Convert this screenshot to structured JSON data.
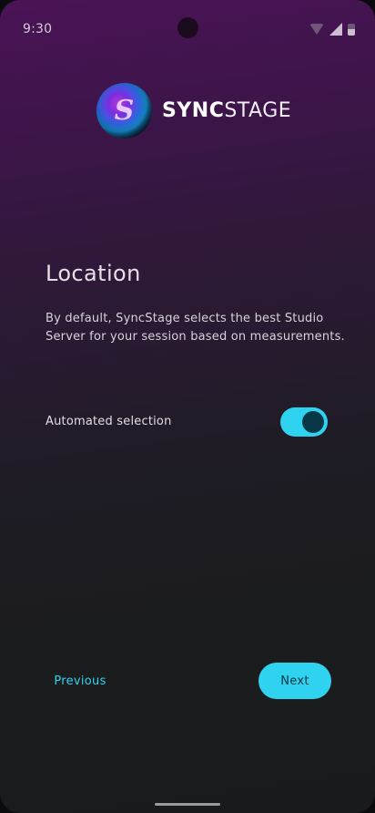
{
  "status_bar": {
    "time": "9:30",
    "icons": [
      "wifi-icon",
      "signal-icon",
      "battery-icon"
    ]
  },
  "logo": {
    "mark": "S",
    "text_bold": "SYNC",
    "text_light": "STAGE"
  },
  "screen": {
    "title": "Location",
    "description": "By default, SyncStage selects the best Studio Server for your session based on measurements."
  },
  "setting": {
    "label": "Automated selection",
    "enabled": true
  },
  "navigation": {
    "previous_label": "Previous",
    "next_label": "Next"
  },
  "colors": {
    "accent": "#2fd3f0",
    "background_top": "#4a1356",
    "background_bottom": "#181b1b"
  }
}
